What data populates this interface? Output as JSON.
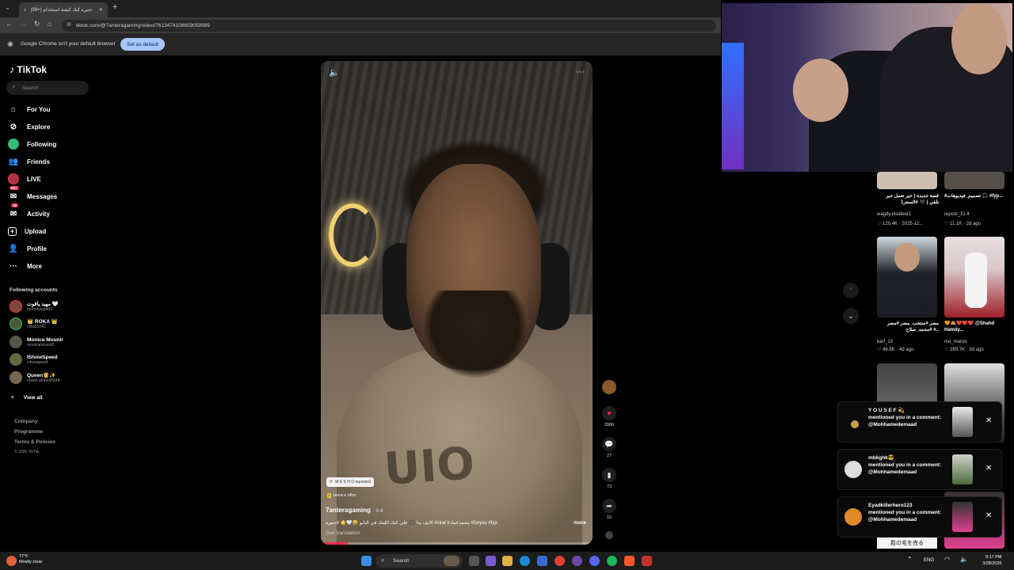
{
  "browser": {
    "tab_title": "(99+) حتيرة كيك كيفية استخدام",
    "url": "tiktok.com/@7anteragaming/video/7613474108659059989",
    "infobar_text": "Google Chrome isn't your default browser",
    "infobar_button": "Set as default"
  },
  "sidebar": {
    "logo": "TikTok",
    "search_placeholder": "Search",
    "nav": [
      {
        "label": "For You",
        "icon": "home-icon"
      },
      {
        "label": "Explore",
        "icon": "compass-icon"
      },
      {
        "label": "Following",
        "icon": "following-icon"
      },
      {
        "label": "Friends",
        "icon": "friends-icon"
      },
      {
        "label": "LIVE",
        "icon": "live-icon"
      },
      {
        "label": "Messages",
        "icon": "messages-icon",
        "badge": "99+"
      },
      {
        "label": "Activity",
        "icon": "activity-icon",
        "badge": "16"
      },
      {
        "label": "Upload",
        "icon": "upload-icon"
      },
      {
        "label": "Profile",
        "icon": "profile-icon"
      },
      {
        "label": "More",
        "icon": "more-icon"
      }
    ],
    "following_title": "Following accounts",
    "accounts": [
      {
        "name": "مهيد ياقوت 🤍",
        "handle": "mohrayaqut01"
      },
      {
        "name": "👑 ROKA 👑",
        "handle": "roka51042"
      },
      {
        "name": "Monica Mounir",
        "handle": "monicamounir5"
      },
      {
        "name": "IShowSpeed",
        "handle": "ishowspeed"
      },
      {
        "name": "Queen👸✨",
        "handle": "rawan.ahmed5648"
      }
    ],
    "view_all": "View all",
    "footer": [
      "Company",
      "Programme",
      "Terms & Policies",
      "© 2026 TikTok"
    ]
  },
  "video": {
    "reposted_label": "M E S H O reposted",
    "music": "boca e olho",
    "author": "7anteragaming",
    "date": "· 3-4",
    "caption": "الايف بداً 🎧 علي كيك اللينك في البايو 😂🤍🌟 #حتيرة #viral #محمدعماد #foryou #fyp",
    "more": "more",
    "see_translation": "See translation",
    "progress": 0.1,
    "shirt_text": "UIO"
  },
  "actions": {
    "likes": "2986",
    "comments": "27",
    "saves": "73",
    "shares": "10"
  },
  "grid": [
    {
      "title": "قصة جديدة ( خير تعمل خير تلقي ) 🖤 #السعر1",
      "handle": "wagdy.elsafeer1",
      "stats": "♡ 120.4K · 2025-12..."
    },
    {
      "title": "#تصميم_فيديوهات 🎧 #fyp...",
      "handle": "repost_31.4",
      "stats": "♡ 11.1K · 2d ago"
    },
    {
      "title": "مصر #منتخب_مصر #مصر #محمد_صلاح #..",
      "handle": "karf_13",
      "stats": "♡ 46.8K · 4d ago"
    },
    {
      "title": "🧡🙈❤️❤️❤️ @Shahd Hamdy...",
      "handle": "mo_maroo",
      "stats": "♡ 289.7K · 3d ago"
    },
    {
      "title": "",
      "handle": "",
      "stats": ""
    },
    {
      "title": "",
      "handle": "",
      "stats": ""
    }
  ],
  "notifications": [
    {
      "name": "Y O U S E F 💫",
      "text": "mentioned you in a comment:",
      "mention": "@Mohhamedemaad"
    },
    {
      "name": "mbkghk😎",
      "text": "mentioned you in a comment:",
      "mention": "@Mohhamedemaad"
    },
    {
      "name": "Eyadkillerhero123",
      "text": "mentioned you in a comment:",
      "mention": "@Mohhamedemaad"
    }
  ],
  "bottom_thumb_text": "鬆の毛を売る",
  "taskbar": {
    "weather_temp": "77°F",
    "weather_desc": "Mostly clear",
    "search": "Search",
    "lang": "ENG",
    "time": "9:17 PM",
    "date": "3/28/2026"
  },
  "colors": {
    "accent": "#fe2c55",
    "chrome_button": "#a8c7fa"
  }
}
